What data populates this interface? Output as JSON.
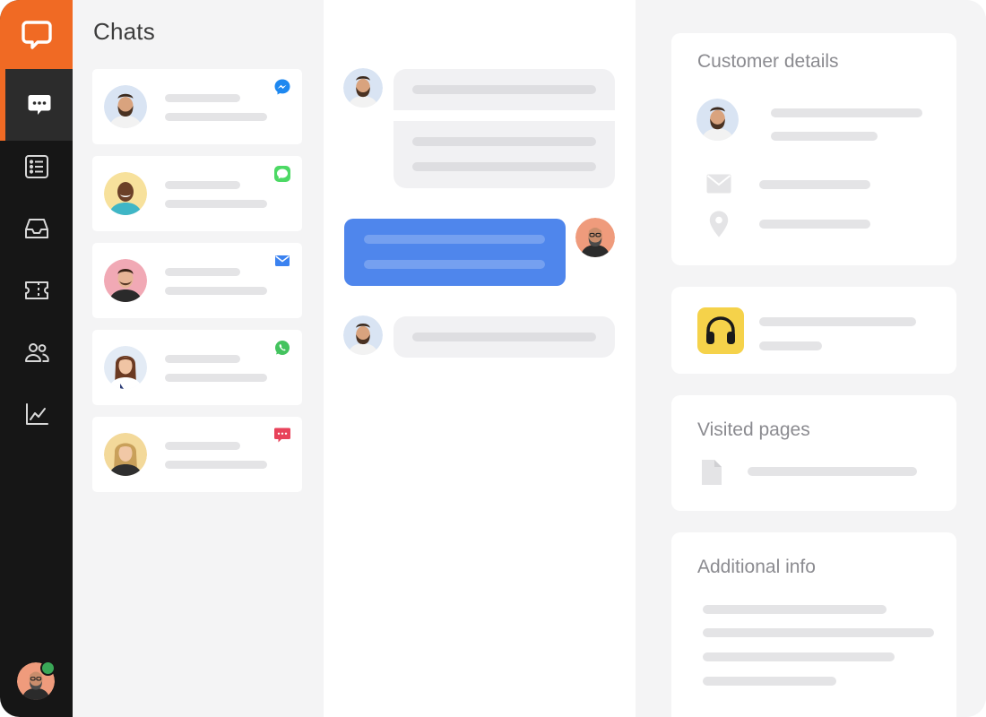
{
  "colors": {
    "brand": "#f06a24",
    "nav_bg": "#161616",
    "online": "#3aa757",
    "agent_bubble": "#4f86ec"
  },
  "nav": {
    "logo_icon": "chat-bubble-logo-icon",
    "items": [
      {
        "icon": "chats-icon",
        "active": true
      },
      {
        "icon": "list-icon"
      },
      {
        "icon": "inbox-icon"
      },
      {
        "icon": "ticket-icon"
      },
      {
        "icon": "customers-icon"
      },
      {
        "icon": "reports-icon"
      }
    ],
    "user_status": "online"
  },
  "chats": {
    "title": "Chats",
    "items": [
      {
        "channel": "messenger-icon",
        "channel_color": "#1e88f0"
      },
      {
        "channel": "imessage-icon",
        "channel_color": "#4cd964"
      },
      {
        "channel": "email-icon",
        "channel_color": "#3b82f0"
      },
      {
        "channel": "whatsapp-icon",
        "channel_color": "#43c35e"
      },
      {
        "channel": "sms-icon",
        "channel_color": "#e8425a"
      }
    ]
  },
  "details": {
    "customer_title": "Customer details",
    "visited_title": "Visited pages",
    "additional_title": "Additional info"
  }
}
